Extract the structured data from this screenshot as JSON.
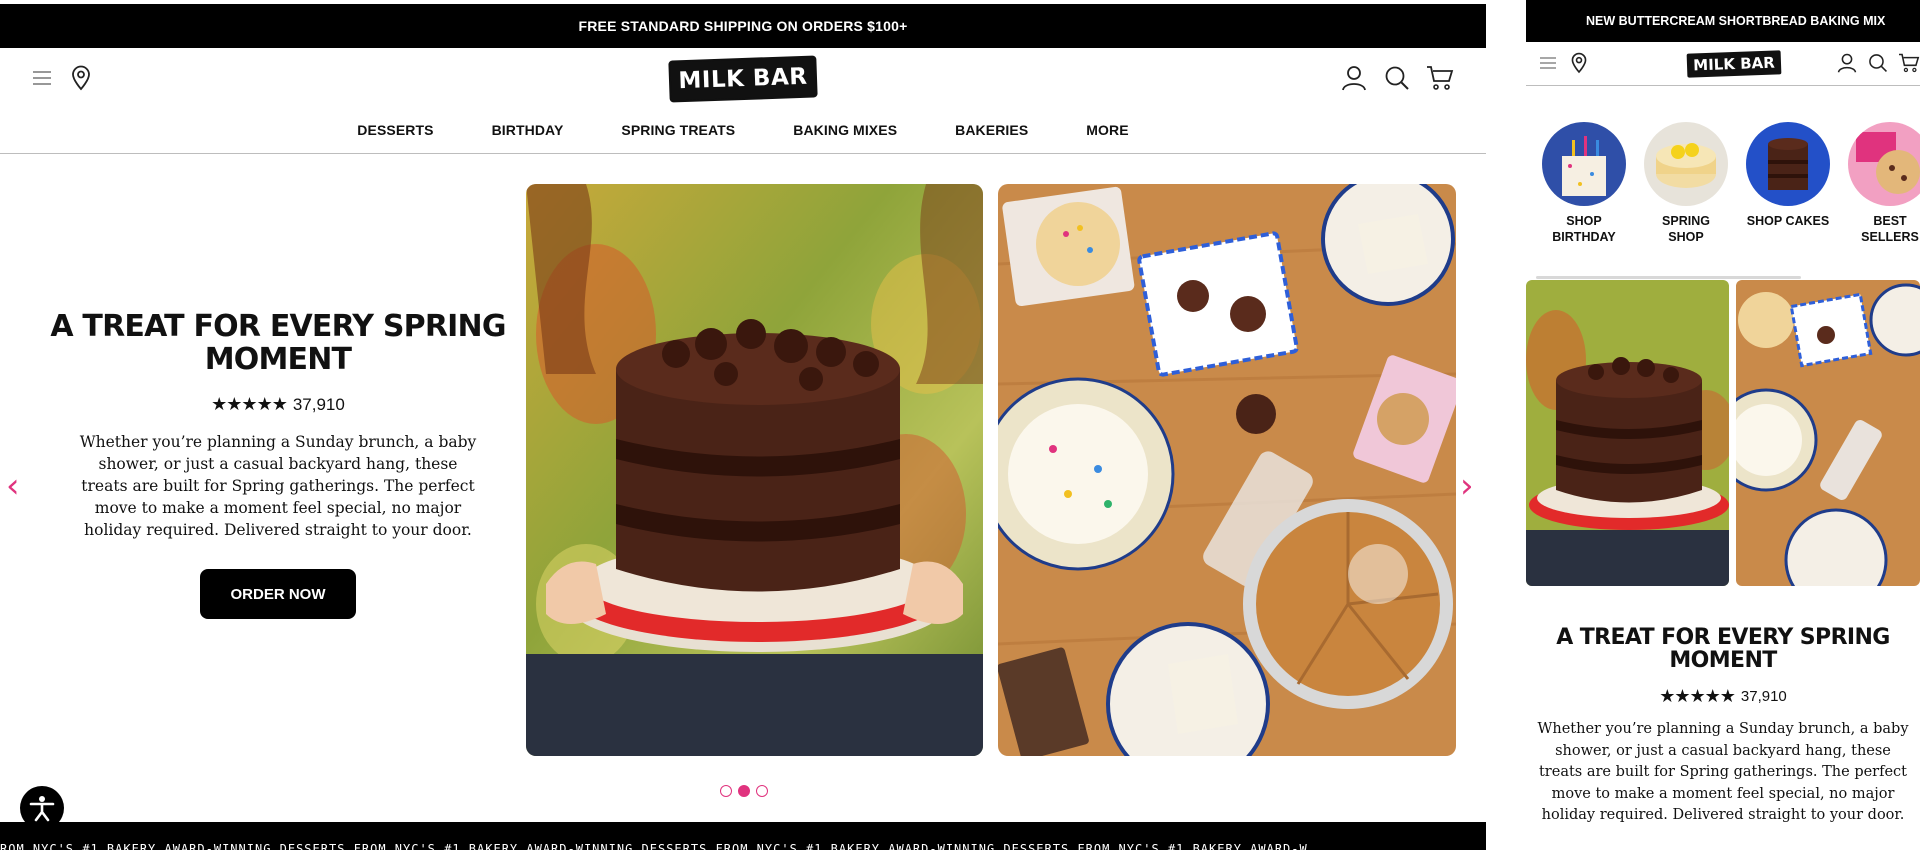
{
  "desktop": {
    "promo": {
      "text": "FREE STANDARD SHIPPING ON ORDERS $100+"
    },
    "header": {
      "logo_text": "MILK BAR",
      "nav": [
        {
          "label": "DESSERTS"
        },
        {
          "label": "BIRTHDAY"
        },
        {
          "label": "SPRING TREATS"
        },
        {
          "label": "BAKING MIXES"
        },
        {
          "label": "BAKERIES"
        },
        {
          "label": "MORE"
        }
      ],
      "icons": [
        "menu-icon",
        "location-pin-icon",
        "account-icon",
        "search-icon",
        "cart-icon"
      ]
    },
    "hero": {
      "title": "A TREAT FOR EVERY SPRING MOMENT",
      "stars": "★★★★★",
      "review_count": "37,910",
      "description": "Whether you’re planning a Sunday brunch, a baby shower, or just a casual backyard hang, these treats are built for Spring gatherings. The perfect move to make a moment feel special, no major holiday required. Delivered straight to your door.",
      "cta": "ORDER NOW",
      "prev_arrow": "‹",
      "next_arrow": "›",
      "carousel_slides": 3,
      "active_slide": 2
    },
    "ticker": {
      "text": "ROM NYC'S #1 BAKERY     AWARD-WINNING DESSERTS FROM NYC'S #1 BAKERY     AWARD-WINNING DESSERTS FROM NYC'S #1 BAKERY     AWARD-WINNING DESSERTS FROM NYC'S #1 BAKERY     AWARD-W"
    }
  },
  "mobile": {
    "promo": {
      "text": "NEW BUTTERCREAM SHORTBREAD BAKING MIX"
    },
    "logo_text": "MILK BAR",
    "categories": [
      {
        "label": "SHOP BIRTHDAY"
      },
      {
        "label": "SPRING SHOP"
      },
      {
        "label": "SHOP CAKES"
      },
      {
        "label": "BEST SELLERS"
      }
    ],
    "hero": {
      "title": "A TREAT FOR EVERY SPRING MOMENT",
      "stars": "★★★★★",
      "review_count": "37,910",
      "description": "Whether you’re planning a Sunday brunch, a baby shower, or just a casual backyard hang, these treats are built for Spring gatherings. The perfect move to make a moment feel special, no major holiday required. Delivered straight to your door."
    }
  },
  "colors": {
    "accent_pink": "#e0337e",
    "black": "#000000",
    "cake_brown": "#4a2317",
    "plate_red": "#e22a2a",
    "table_wood": "#c98a4a"
  }
}
